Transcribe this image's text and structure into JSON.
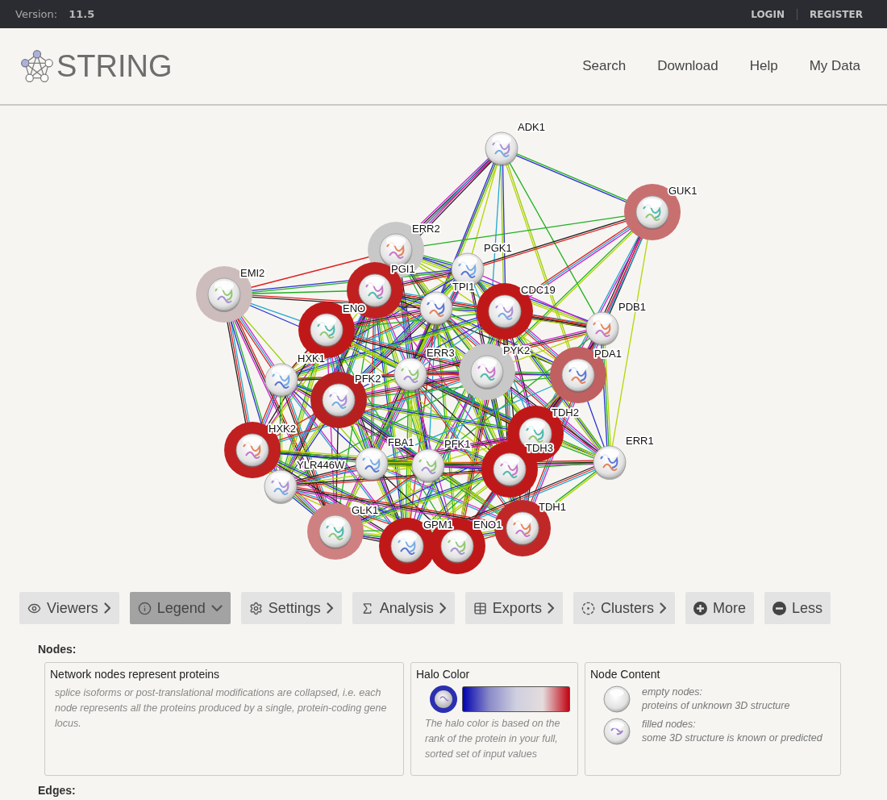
{
  "header": {
    "version_label": "Version:",
    "version": "11.5",
    "account_links": [
      {
        "label": "LOGIN"
      },
      {
        "label": "REGISTER"
      }
    ]
  },
  "brand": {
    "name": "STRING"
  },
  "nav": [
    {
      "label": "Search"
    },
    {
      "label": "Download"
    },
    {
      "label": "Help"
    },
    {
      "label": "My Data"
    }
  ],
  "network": {
    "nodes": [
      {
        "label": "ADK1"
      },
      {
        "label": "GUK1",
        "color": "#c87070"
      },
      {
        "label": "ERR2",
        "color": "#c8c8c8"
      },
      {
        "label": "PGK1"
      },
      {
        "label": "EMI2",
        "color": "#cdbcbc"
      },
      {
        "label": "PGI1",
        "color": "#c02020"
      },
      {
        "label": "TPI1"
      },
      {
        "label": "CDC19",
        "color": "#c01818"
      },
      {
        "label": "ENO",
        "color": "#c01818"
      },
      {
        "label": "PDB1"
      },
      {
        "label": "HXK1"
      },
      {
        "label": "ERR3"
      },
      {
        "label": "PYK2",
        "color": "#c8c8c8"
      },
      {
        "label": "PDA1",
        "color": "#c06060"
      },
      {
        "label": "PFK2",
        "color": "#b82020"
      },
      {
        "label": "TDH2",
        "color": "#c01818"
      },
      {
        "label": "HXK2",
        "color": "#c02020"
      },
      {
        "label": "FBA1"
      },
      {
        "label": "PFK1"
      },
      {
        "label": "TDH3",
        "color": "#c01818"
      },
      {
        "label": "ERR1"
      },
      {
        "label": "YLR446W"
      },
      {
        "label": "GLK1",
        "color": "#cf8080"
      },
      {
        "label": "TDH1",
        "color": "#c02828"
      },
      {
        "label": "GPM1",
        "color": "#c01818"
      },
      {
        "label": "ENO1",
        "color": "#c01818"
      }
    ]
  },
  "toolbar": [
    {
      "label": "Viewers",
      "kind": "menu",
      "selected": false
    },
    {
      "label": "Legend",
      "kind": "menu",
      "selected": true
    },
    {
      "label": "Settings",
      "kind": "menu",
      "selected": false
    },
    {
      "label": "Analysis",
      "kind": "menu",
      "selected": false
    },
    {
      "label": "Exports",
      "kind": "menu",
      "selected": false
    },
    {
      "label": "Clusters",
      "kind": "menu",
      "selected": false
    },
    {
      "label": "More",
      "kind": "action",
      "selected": false
    },
    {
      "label": "Less",
      "kind": "action",
      "selected": false
    }
  ],
  "legend": {
    "heading": "Nodes:",
    "panels": [
      {
        "kind": "text",
        "title": "Network nodes represent proteins",
        "text": "splice isoforms or post-translational modifications are collapsed, i.e. each node represents all the proteins produced by a single, protein-coding gene locus."
      },
      {
        "kind": "halo",
        "title": "Halo Color",
        "text": "The halo color is based on the rank of the protein in your full, sorted set of input values"
      },
      {
        "kind": "content",
        "title": "Node Content",
        "items": [
          {
            "kind": "empty",
            "title": "empty nodes:",
            "text": "proteins of unknown 3D structure"
          },
          {
            "kind": "filled",
            "title": "filled nodes:",
            "text": "some 3D structure is known or predicted"
          }
        ]
      }
    ],
    "next_heading": "Edges:"
  }
}
